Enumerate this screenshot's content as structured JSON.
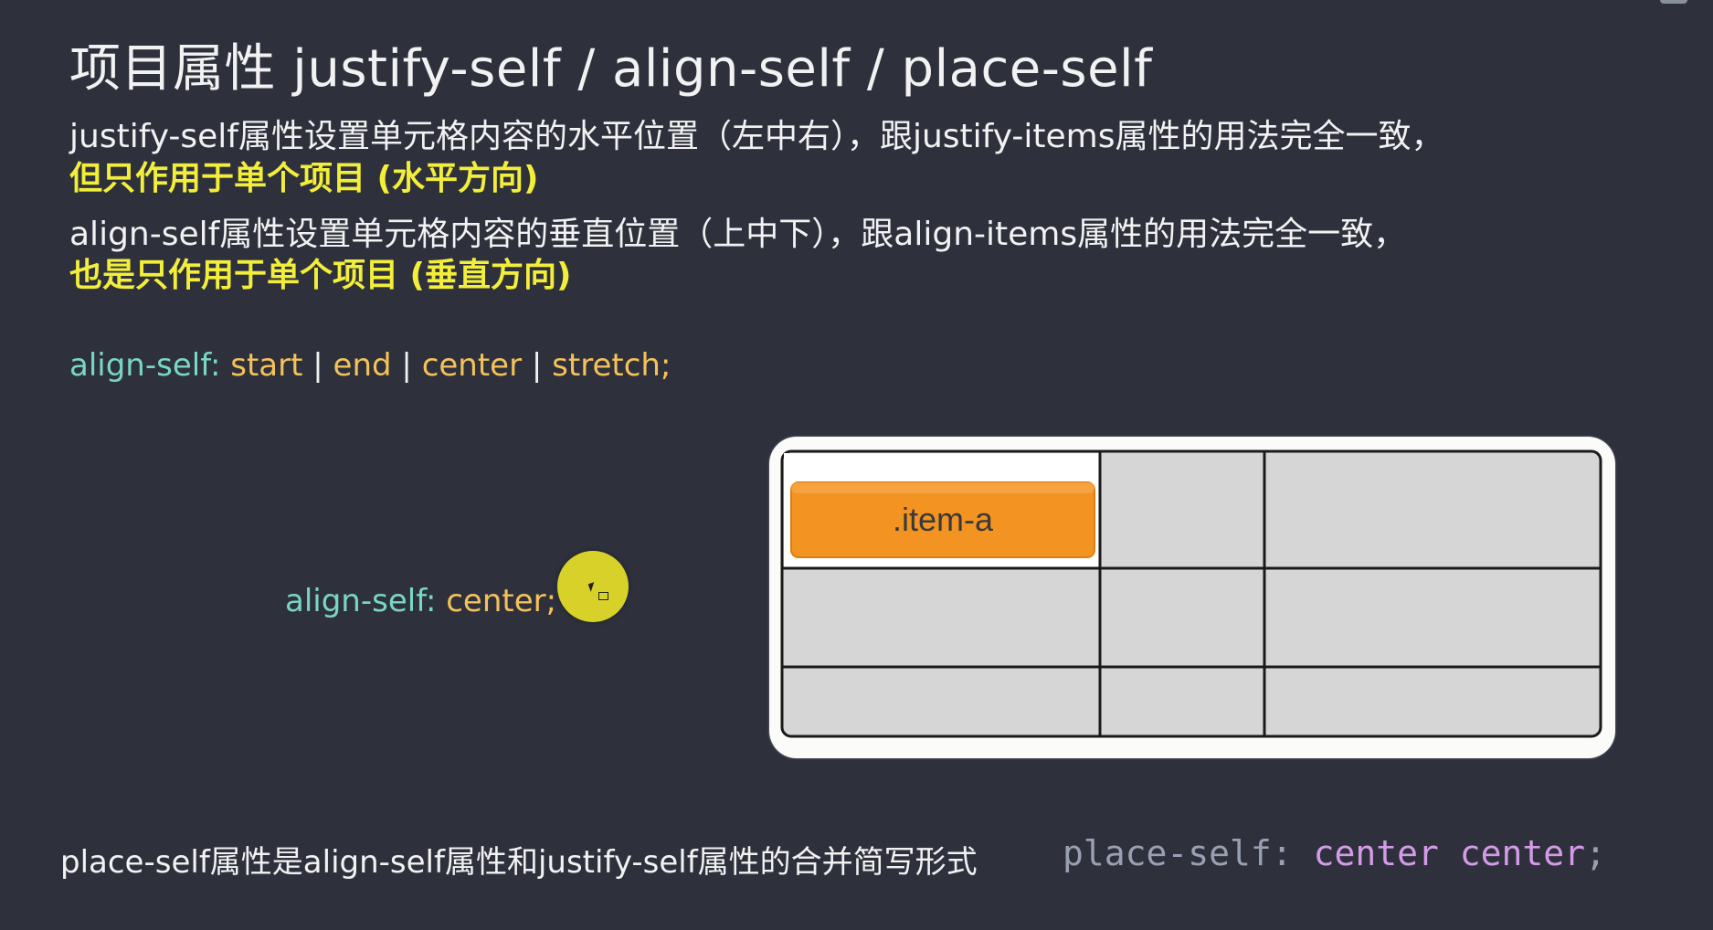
{
  "title": "项目属性  justify-self / align-self  / place-self",
  "desc": {
    "justify_line": "justify-self属性设置单元格内容的水平位置（左中右），跟justify-items属性的用法完全一致，",
    "justify_highlight": "但只作用于单个项目 (水平方向)",
    "align_line": "align-self属性设置单元格内容的垂直位置（上中下），跟align-items属性的用法完全一致，",
    "align_highlight": "也是只作用于单个项目 (垂直方向)"
  },
  "syntax": {
    "property": "align-self:",
    "values": [
      "start",
      "end",
      "center",
      "stretch;"
    ],
    "separator": "|"
  },
  "current": {
    "property": "align-self:",
    "value": "center;"
  },
  "grid": {
    "item_label": ".item-a",
    "item_color": "#f39322",
    "cell_color": "#d6d6d6",
    "highlight_cell_color": "#ffffff",
    "line_color": "#1a1a1a"
  },
  "shorthand": {
    "text": "place-self属性是align-self属性和justify-self属性的合并简写形式",
    "code_property": "place-self:",
    "code_values": "center center",
    "code_end": ";"
  },
  "colors": {
    "background": "#2e313c",
    "highlight_text": "#f2ee3a",
    "keyword": "#79d6c4",
    "value": "#f4c15a",
    "code_value": "#d59ae8",
    "cursor": "#d8d12a"
  }
}
